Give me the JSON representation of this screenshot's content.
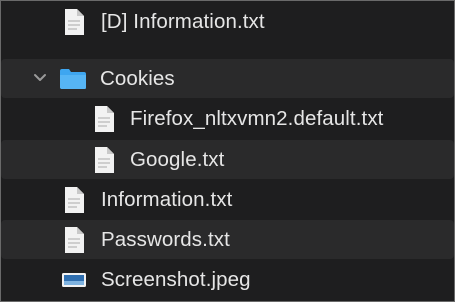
{
  "file_list": {
    "items": [
      {
        "name": "[D] Information.txt",
        "kind": "text-file-icon",
        "expanded": null
      },
      {
        "name": "Cookies",
        "kind": "folder-icon",
        "expanded": true
      },
      {
        "name": "Firefox_nltxvmn2.default.txt",
        "kind": "text-file-icon",
        "expanded": null
      },
      {
        "name": "Google.txt",
        "kind": "text-file-icon",
        "expanded": null
      },
      {
        "name": "Information.txt",
        "kind": "text-file-icon",
        "expanded": null
      },
      {
        "name": "Passwords.txt",
        "kind": "text-file-icon",
        "expanded": null
      },
      {
        "name": "Screenshot.jpeg",
        "kind": "image-file-icon",
        "expanded": null
      }
    ]
  },
  "colors": {
    "background": "#1e1e1f",
    "alternate_row": "#2a2a2b",
    "text": "#e6e6e6",
    "folder_blue": "#3ea6f0",
    "file_white": "#f2f2f2"
  }
}
